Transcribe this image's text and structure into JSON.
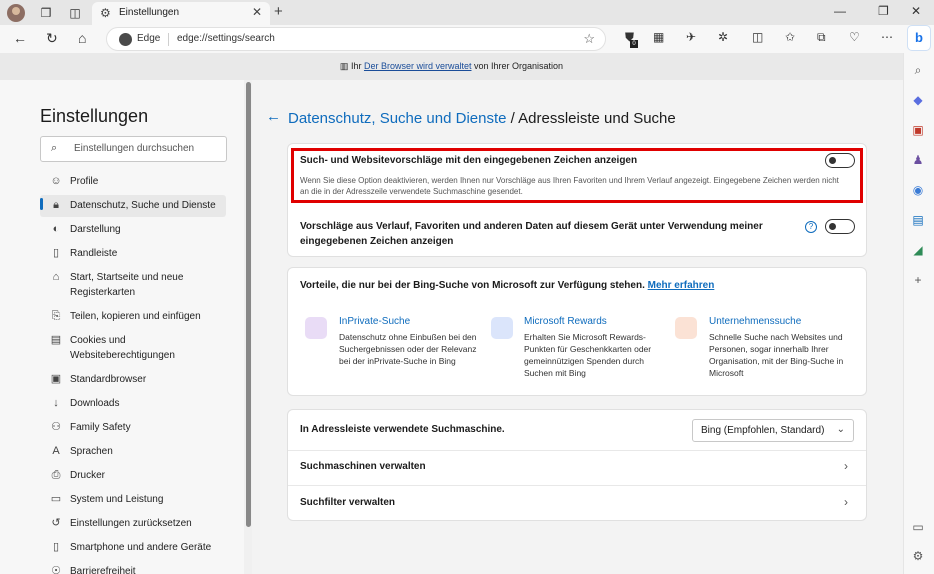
{
  "tabbar": {
    "tab_title": "Einstellungen"
  },
  "toolbar": {
    "edge_label": "Edge",
    "url": "edge://settings/search",
    "ext_badge": "0"
  },
  "infobar": {
    "prefix": "Ihr",
    "link": "Der Browser wird verwaltet",
    "suffix": "von Ihrer Organisation"
  },
  "sidebar": {
    "title": "Einstellungen",
    "search_placeholder": "Einstellungen durchsuchen",
    "items": [
      {
        "label": "Profile",
        "icon": "person-icon"
      },
      {
        "label": "Datenschutz, Suche und Dienste",
        "icon": "lock-icon",
        "active": true
      },
      {
        "label": "Darstellung",
        "icon": "palette-icon"
      },
      {
        "label": "Randleiste",
        "icon": "sidebar-icon"
      },
      {
        "label": "Start, Startseite und neue Registerkarten",
        "icon": "home-icon"
      },
      {
        "label": "Teilen, kopieren und einfügen",
        "icon": "share-icon"
      },
      {
        "label": "Cookies und Websiteberechtigungen",
        "icon": "cookie-icon"
      },
      {
        "label": "Standardbrowser",
        "icon": "browser-icon"
      },
      {
        "label": "Downloads",
        "icon": "download-icon"
      },
      {
        "label": "Family Safety",
        "icon": "family-icon"
      },
      {
        "label": "Sprachen",
        "icon": "language-icon"
      },
      {
        "label": "Drucker",
        "icon": "printer-icon"
      },
      {
        "label": "System und Leistung",
        "icon": "system-icon"
      },
      {
        "label": "Einstellungen zurücksetzen",
        "icon": "reset-icon"
      },
      {
        "label": "Smartphone und andere Geräte",
        "icon": "phone-icon"
      },
      {
        "label": "Barrierefreiheit",
        "icon": "accessibility-icon"
      }
    ]
  },
  "main": {
    "crumb_link": "Datenschutz, Suche und Dienste",
    "crumb_current": " / Adressleiste und Suche",
    "option1": {
      "title": "Such- und Websitevorschläge mit den eingegebenen Zeichen anzeigen",
      "desc": "Wenn Sie diese Option deaktivieren, werden Ihnen nur Vorschläge aus Ihren Favoriten und Ihrem Verlauf angezeigt. Eingegebene Zeichen werden nicht an die in der Adresszeile verwendete Suchmaschine gesendet.",
      "enabled": false
    },
    "option2": {
      "title": "Vorschläge aus Verlauf, Favoriten und anderen Daten auf diesem Gerät unter Verwendung meiner eingegebenen Zeichen anzeigen",
      "help": "?",
      "enabled": false
    },
    "bing": {
      "heading": "Vorteile, die nur bei der Bing-Suche von Microsoft zur Verfügung stehen.",
      "link": "Mehr erfahren",
      "features": [
        {
          "title": "InPrivate-Suche",
          "desc": "Datenschutz ohne Einbußen bei den Suchergebnissen oder der Relevanz bei der inPrivate-Suche in Bing",
          "icon": "inprivate-icon",
          "color": "#b084d6"
        },
        {
          "title": "Microsoft Rewards",
          "desc": "Erhalten Sie Microsoft Rewards-Punkten für Geschenkkarten oder gemeinnützigen Spenden durch Suchen mit Bing",
          "icon": "rewards-icon",
          "color": "#3f6fd8"
        },
        {
          "title": "Unternehmenssuche",
          "desc": "Schnelle Suche nach Websites und Personen, sogar innerhalb Ihrer Organisation, mit der Bing-Suche in Microsoft",
          "icon": "enterprise-search-icon",
          "color": "#e9a07a"
        }
      ]
    },
    "engine": {
      "label": "In Adressleiste verwendete Suchmaschine.",
      "value": "Bing (Empfohlen, Standard)"
    },
    "manage_engines": "Suchmaschinen verwalten",
    "manage_filters": "Suchfilter verwalten"
  }
}
